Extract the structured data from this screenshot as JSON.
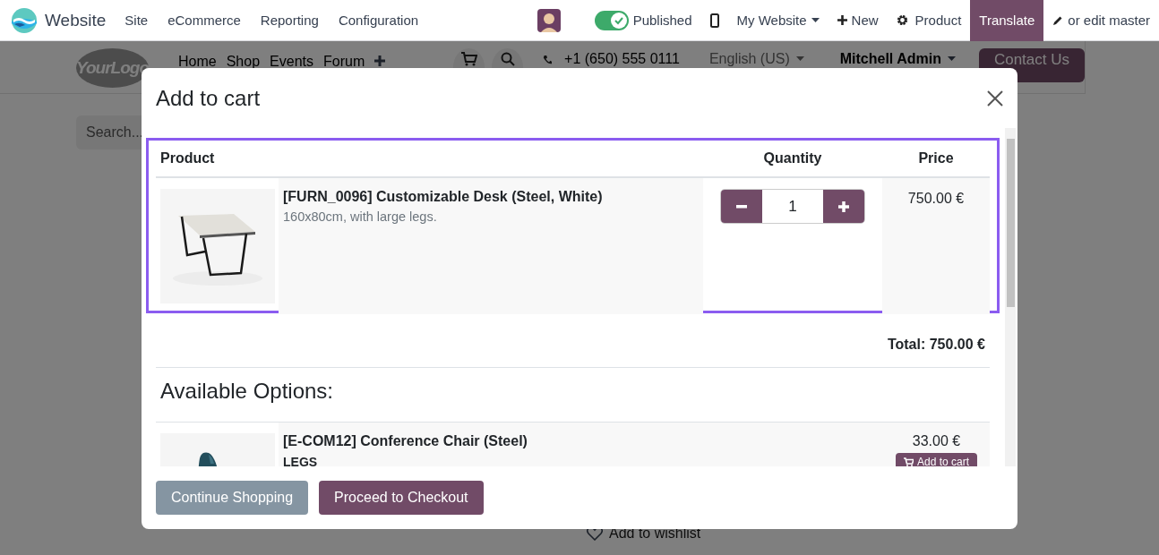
{
  "topbar": {
    "app": "Website",
    "menu": [
      "Site",
      "eCommerce",
      "Reporting",
      "Configuration"
    ],
    "published": {
      "label": "Published",
      "on": true
    },
    "website": "My Website",
    "new": "New",
    "product": "Product",
    "translate": "Translate",
    "edit": "or edit master"
  },
  "site": {
    "logo": "YourLogo",
    "nav": [
      "Home",
      "Shop",
      "Events",
      "Forum"
    ],
    "phone": "+1 (650) 555 0111",
    "language": "English (US)",
    "user": "Mitchell Admin",
    "contact": "Contact Us",
    "search_placeholder": "Search...",
    "wishlist": "Add to wishlist"
  },
  "modal": {
    "title": "Add to cart",
    "columns": [
      "Product",
      "Quantity",
      "Price"
    ],
    "product": {
      "name": "[FURN_0096] Customizable Desk (Steel, White)",
      "description": "160x80cm, with large legs.",
      "quantity": "1",
      "price": "750.00 €"
    },
    "total": "Total: 750.00 €",
    "options_title": "Available Options:",
    "options": [
      {
        "name": "[E-COM12] Conference Chair (Steel)",
        "attribute": "LEGS",
        "price": "33.00 €",
        "button": "Add to cart"
      }
    ],
    "buttons": [
      "Continue Shopping",
      "Proceed to Checkout"
    ]
  }
}
